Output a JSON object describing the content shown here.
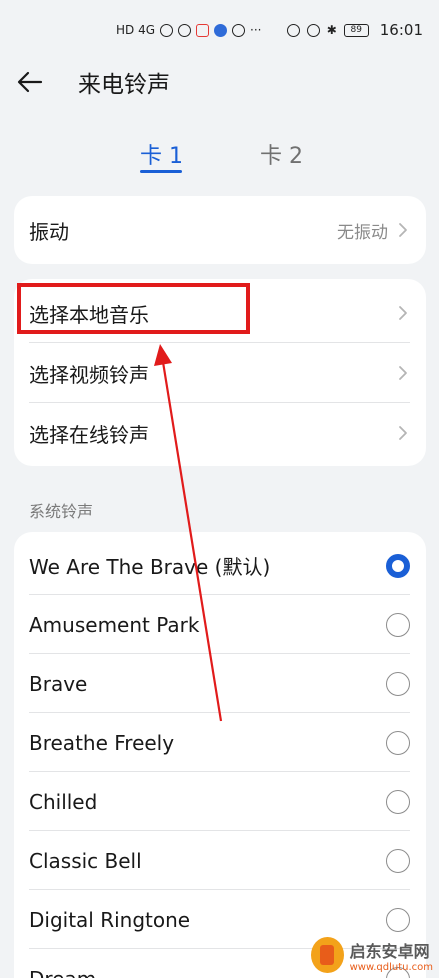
{
  "status_bar": {
    "network": "HD 4G",
    "battery": "89",
    "time": "16:01",
    "more": "···"
  },
  "header": {
    "back_icon": "arrow-left-icon",
    "title": "来电铃声"
  },
  "tabs": [
    {
      "label": "卡 1",
      "active": true
    },
    {
      "label": "卡 2",
      "active": false
    }
  ],
  "vibration": {
    "label": "振动",
    "value": "无振动"
  },
  "sources": [
    {
      "label": "选择本地音乐"
    },
    {
      "label": "选择视频铃声"
    },
    {
      "label": "选择在线铃声"
    }
  ],
  "system_section": {
    "label": "系统铃声",
    "items": [
      {
        "label": "We Are The Brave (默认)",
        "selected": true
      },
      {
        "label": "Amusement Park",
        "selected": false
      },
      {
        "label": "Brave",
        "selected": false
      },
      {
        "label": "Breathe Freely",
        "selected": false
      },
      {
        "label": "Chilled",
        "selected": false
      },
      {
        "label": "Classic Bell",
        "selected": false
      },
      {
        "label": "Digital Ringtone",
        "selected": false
      },
      {
        "label": "Dream",
        "selected": false
      }
    ]
  },
  "watermark": {
    "title": "启东安卓网",
    "url": "www.qdlutu.com"
  },
  "colors": {
    "accent": "#1a5fd6",
    "annotation": "#e11b1b",
    "background": "#f1f3f5"
  }
}
